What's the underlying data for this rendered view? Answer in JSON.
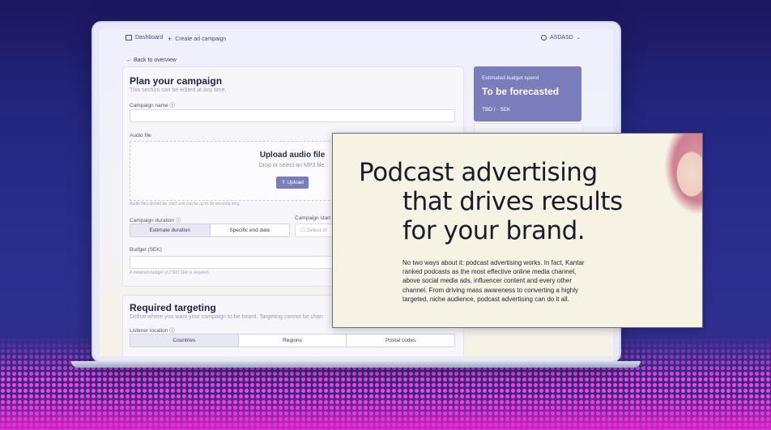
{
  "nav": {
    "dashboard": "Dashboard",
    "create": "Create ad campaign",
    "account": "ASDASD"
  },
  "back_link": "Back to overview",
  "plan": {
    "title": "Plan your campaign",
    "subtitle": "This section can be edited at any time.",
    "campaign_name_label": "Campaign name",
    "audio_file_label": "Audio file",
    "upload_title": "Upload audio file",
    "upload_hint": "Drop or select an MP3 file.",
    "upload_button": "Upload",
    "audio_note": "Audio files should be .mp3 and can be up to 30 seconds long.",
    "duration_label": "Campaign duration",
    "duration_options": [
      "Estimate duration",
      "Specific end date"
    ],
    "start_label": "Campaign start",
    "start_placeholder": "Select st",
    "budget_label": "Budget (SEK)",
    "budget_note": "A minimum budget of 2 500 SEK is required."
  },
  "targeting": {
    "title": "Required targeting",
    "subtitle": "Define where you want your campaign to be heard. Targeting cannot be chan",
    "location_label": "Listener location",
    "location_options": [
      "Countries",
      "Regions",
      "Postal codes"
    ]
  },
  "budget_card": {
    "label": "Estimated budget spend",
    "value": "To be forecasted",
    "sub": "TBD / - SEK"
  },
  "promo": {
    "line1": "Podcast advertising",
    "line2": "that drives results",
    "line3": "for your brand.",
    "body": "No two ways about it: podcast advertising works. In fact, Kantar ranked podcasts as the most effective online media channel, above social media ads, influencer content and every other channel. From driving mass awareness to converting a highly targeted, niche audience, podcast advertising can do it all."
  },
  "colors": {
    "accent": "#7b7dbb",
    "background": "#262a86",
    "halftone": "#ff3fd8"
  }
}
